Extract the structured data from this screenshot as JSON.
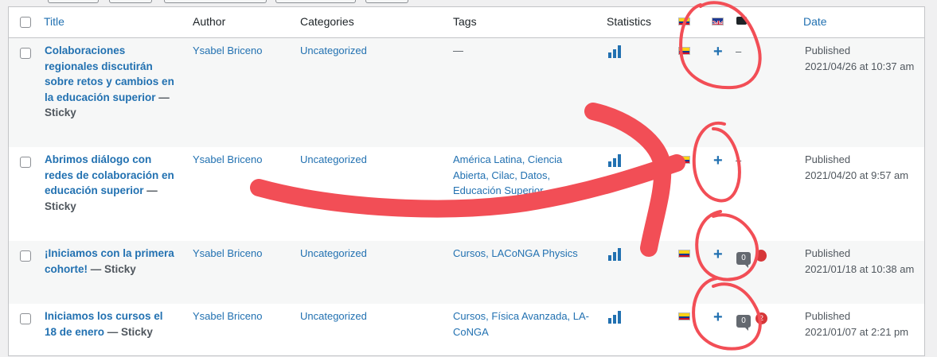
{
  "header": {
    "title": "Title",
    "author": "Author",
    "categories": "Categories",
    "tags": "Tags",
    "statistics": "Statistics",
    "date": "Date"
  },
  "rows": [
    {
      "title": "Colaboraciones regionales discutirán sobre retos y cambios en la educación superior",
      "sticky": " — Sticky",
      "author": "Ysabel Briceno",
      "category": "Uncategorized",
      "tags": "—",
      "english": "+",
      "comments": "–",
      "status": "Published",
      "date": "2021/04/26 at 10:37 am"
    },
    {
      "title": "Abrimos diálogo con redes de colaboración en educación superior",
      "sticky": " — Sticky",
      "author": "Ysabel Briceno",
      "category": "Uncategorized",
      "tags": "América Latina, Ciencia Abierta, Cilac, Datos, Educación Superior",
      "english": "+",
      "comments": "–",
      "status": "Published",
      "date": "2021/04/20 at 9:57 am"
    },
    {
      "title": "¡Iniciamos con la primera cohorte!",
      "sticky": " — Sticky",
      "author": "Ysabel Briceno",
      "category": "Uncategorized",
      "tags": "Cursos, LACoNGA Physics",
      "english": "+",
      "comments": "0",
      "pending": "",
      "status": "Published",
      "date": "2021/01/18 at 10:38 am"
    },
    {
      "title": "Iniciamos los cursos el 18 de enero",
      "sticky": " — Sticky",
      "author": "Ysabel Briceno",
      "category": "Uncategorized",
      "tags": "Cursos, Física Avanzada, LA-CoNGA",
      "english": "+",
      "comments": "0",
      "pending": "2",
      "status": "Published",
      "date": "2021/01/07 at 2:21 pm"
    }
  ],
  "colors": {
    "link": "#2271b1",
    "annotation": "#f24e56",
    "badge": "#d63638"
  },
  "icons": {
    "column_flag_spanish": "colombia-flag-icon",
    "column_flag_english": "uk-flag-icon",
    "column_comments": "comment-bubble-icon",
    "statistics": "bar-chart-icon",
    "add_translation": "plus-icon"
  }
}
